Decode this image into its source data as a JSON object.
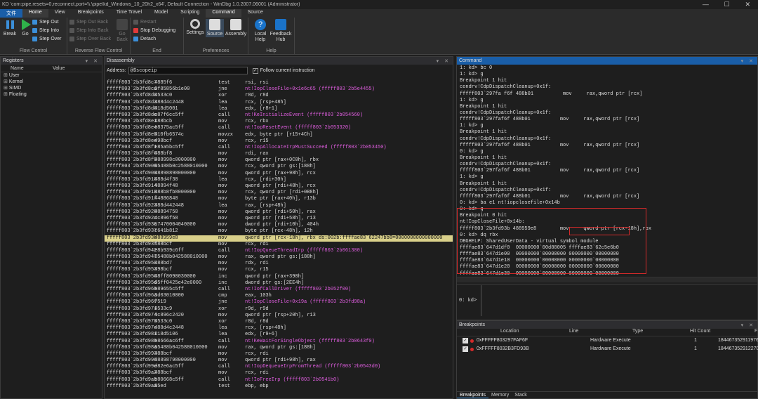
{
  "titlebar": {
    "title": "KD 'com:pipe,resets=0,reconnect,port=\\\\.\\pipe\\kd_Windows_10_20h2_x64', Default Connection  - WinDbg 1.0.2007.06001 (Administrator)"
  },
  "menu": [
    "文件",
    "Home",
    "View",
    "Breakpoints",
    "Time Travel",
    "Model",
    "Scripting",
    "Command",
    "Source"
  ],
  "ribbon": {
    "flow_control": {
      "label": "Flow Control",
      "break": "Break",
      "go": "Go",
      "step_out": "Step Out",
      "step_into": "Step Into",
      "step_over": "Step Over"
    },
    "reverse": {
      "label": "Reverse Flow Control",
      "step_out_back": "Step Out Back",
      "step_into_back": "Step Into Back",
      "step_over_back": "Step Over Back",
      "go_back": "Go Back"
    },
    "end": {
      "label": "End",
      "restart": "Restart",
      "stop": "Stop Debugging",
      "detach": "Detach"
    },
    "prefs": {
      "label": "Preferences",
      "settings": "Settings",
      "source": "Source",
      "assembly": "Assembly"
    },
    "help": {
      "local_help": "Local Help",
      "feedback_hub": "Feedback Hub",
      "help_label": "Help"
    }
  },
  "registers": {
    "title": "Registers",
    "col_name": "Name",
    "col_value": "Value",
    "items": [
      "User",
      "Kernel",
      "SIMD",
      "Floating"
    ]
  },
  "disassembly": {
    "title": "Disassembly",
    "address_label": "Address:",
    "address_value": "@$scopeip",
    "follow_label": "Follow current instruction",
    "rows": [
      [
        "fffff803`2b3fd8c7",
        "4885f6",
        "test",
        "rsi, rsi",
        0
      ],
      [
        "fffff803`2b3fd8ca",
        "0f85856b1e00",
        "jne",
        "nt!IopCloseFile+0x1e6c65 (fffff803`2b5e4455)",
        1
      ],
      [
        "fffff803`2b3fd8d0",
        "4533c0",
        "xor",
        "r8d, r8d",
        0
      ],
      [
        "fffff803`2b3fd8d3",
        "488d4c2448",
        "lea",
        "rcx, [rsp+48h]",
        0
      ],
      [
        "fffff803`2b3fd8d8",
        "418d5001",
        "lea",
        "edx, [r8+1]",
        0
      ],
      [
        "fffff803`2b3fd8dc",
        "e87f6cc5ff",
        "call",
        "nt!KeInitializeEvent (fffff803`2b054560)",
        1
      ],
      [
        "fffff803`2b3fd8e1",
        "488bcb",
        "mov",
        "rcx, rbx",
        0
      ],
      [
        "fffff803`2b3fd8e4",
        "e8375ac5ff",
        "call",
        "nt!IopResetEvent (fffff803`2b053320)",
        1
      ],
      [
        "fffff803`2b3fd8e9",
        "410fb6574c",
        "movzx",
        "edx, byte ptr [r15+4Ch]",
        0
      ],
      [
        "fffff803`2b3fd8ee",
        "498bcf",
        "mov",
        "rcx, r15",
        0
      ],
      [
        "fffff803`2b3fd8f1",
        "e85a5bc5ff",
        "call",
        "nt!IopAllocateIrpMustSucceed (fffff803`2b053450)",
        1
      ],
      [
        "fffff803`2b3fd8f6",
        "488bf8",
        "mov",
        "rdi, rax",
        0
      ],
      [
        "fffff803`2b3fd8f9",
        "488998c0000000",
        "mov",
        "qword ptr [rax+0C0h], rbx",
        0
      ],
      [
        "fffff803`2b3fd900",
        "65488b0c2588010000",
        "mov",
        "rcx, qword ptr gs:[188h]",
        0
      ],
      [
        "fffff803`2b3fd909",
        "48898898000000",
        "mov",
        "qword ptr [rax+98h], rcx",
        0
      ],
      [
        "fffff803`2b3fd910",
        "488d4f30",
        "lea",
        "rcx, [rdi+30h]",
        0
      ],
      [
        "fffff803`2b3fd914",
        "48894f48",
        "mov",
        "qword ptr [rdi+48h], rcx",
        0
      ],
      [
        "fffff803`2b3fd918",
        "488b8fb8000000",
        "mov",
        "rcx, qword ptr [rdi+0B8h]",
        0
      ],
      [
        "fffff803`2b3fd91f",
        "44886840",
        "mov",
        "byte ptr [rax+40h], r13b",
        0
      ],
      [
        "fffff803`2b3fd923",
        "488d442448",
        "lea",
        "rax, [rsp+48h]",
        0
      ],
      [
        "fffff803`2b3fd928",
        "48894750",
        "mov",
        "qword ptr [rdi+50h], rax",
        0
      ],
      [
        "fffff803`2b3fd92c",
        "4c896f58",
        "mov",
        "qword ptr [rdi+58h], r13",
        0
      ],
      [
        "fffff803`2b3fd930",
        "c7470004040000",
        "mov",
        "dword ptr [rdi+10h], 404h",
        0
      ],
      [
        "fffff803`2b3fd937",
        "c641b812",
        "mov",
        "byte ptr [rcx-48h], 12h",
        0
      ],
      [
        "fffff803`2b3fd93b",
        "488959e8",
        "mov",
        "qword ptr [rcx-18h], rbx ds:002b:ffffae83`62247bb8=0000000000000000",
        2
      ],
      [
        "fffff803`2b3fd93f",
        "488bcf",
        "mov",
        "rcx, rdi",
        0
      ],
      [
        "fffff803`2b3fd942",
        "e8b939c6ff",
        "call",
        "nt!IopQueueThreadIrp (fffff803`2b061300)",
        1
      ],
      [
        "fffff803`2b3fd947",
        "65488b042588010000",
        "mov",
        "rax, qword ptr gs:[188h]",
        0
      ],
      [
        "fffff803`2b3fd950",
        "488bd7",
        "mov",
        "rdx, rdi",
        0
      ],
      [
        "fffff803`2b3fd953",
        "498bcf",
        "mov",
        "rcx, r15",
        0
      ],
      [
        "fffff803`2b3fd956",
        "48ff8090030000",
        "inc",
        "qword ptr [rax+390h]",
        0
      ],
      [
        "fffff803`2b3fd95d",
        "65ff0425e42e0000",
        "inc",
        "dword ptr gs:[2EE4h]",
        0
      ],
      [
        "fffff803`2b3fd965",
        "e89655c5ff",
        "call",
        "nt!IofCallDriver (fffff803`2b052f00)",
        1
      ],
      [
        "fffff803`2b3fd96a",
        "3d03010000",
        "cmp",
        "eax, 103h",
        0
      ],
      [
        "fffff803`2b3fd96f",
        "7519",
        "jne",
        "nt!IopCloseFile+0x19a (fffff803`2b3fd98a)",
        1
      ],
      [
        "fffff803`2b3fd971",
        "4533c9",
        "xor",
        "r9d, r9d",
        0
      ],
      [
        "fffff803`2b3fd974",
        "4c896c2420",
        "mov",
        "qword ptr [rsp+20h], r13",
        0
      ],
      [
        "fffff803`2b3fd979",
        "4533c0",
        "xor",
        "r8d, r8d",
        0
      ],
      [
        "fffff803`2b3fd97c",
        "488d4c2448",
        "lea",
        "rcx, [rsp+48h]",
        0
      ],
      [
        "fffff803`2b3fd981",
        "418d5106",
        "lea",
        "edx, [r9+6]",
        0
      ],
      [
        "fffff803`2b3fd985",
        "e8666ac6ff",
        "call",
        "nt!KeWaitForSingleObject (fffff803`2b0643f0)",
        1
      ],
      [
        "fffff803`2b3fd98a",
        "65488b042588010000",
        "mov",
        "rax, qword ptr gs:[188h]",
        0
      ],
      [
        "fffff803`2b3fd993",
        "488bcf",
        "mov",
        "rcx, rdi",
        0
      ],
      [
        "fffff803`2b3fd996",
        "48898798000000",
        "mov",
        "qword ptr [rdi+98h], rax",
        0
      ],
      [
        "fffff803`2b3fd99d",
        "e82e6ac5ff",
        "call",
        "nt!IopDequeueIrpFromThread (fffff803`2b0543d0)",
        1
      ],
      [
        "fffff803`2b3fd9a2",
        "488bcf",
        "mov",
        "rcx, rdi",
        0
      ],
      [
        "fffff803`2b3fd9a5",
        "e80668c5ff",
        "call",
        "nt!IoFreeIrp (fffff803`2b0541b0)",
        1
      ],
      [
        "fffff803`2b3fd9aa",
        "85ed",
        "test",
        "ebp, ebp",
        0
      ]
    ]
  },
  "command": {
    "title": "Command",
    "lines": [
      "1: kd> bc 0",
      "1: kd> g",
      "Breakpoint 1 hit",
      "condrv!CdpDispatchCleanup+0x1f:",
      "fffff803`297fa f6f 488b01          mov     rax,qword ptr [rcx]",
      "1: kd> g",
      "Breakpoint 1 hit",
      "condrv!CdpDispatchCleanup+0x1f:",
      "fffff803`297faf6f 488b01          mov     rax,qword ptr [rcx]",
      "1: kd> g",
      "Breakpoint 1 hit",
      "condrv!CdpDispatchCleanup+0x1f:",
      "fffff803`297faf6f 488b01          mov     rax,qword ptr [rcx]",
      "0: kd> g",
      "Breakpoint 1 hit",
      "condrv!CdpDispatchCleanup+0x1f:",
      "fffff803`297faf6f 488b01          mov     rax,qword ptr [rcx]",
      "1: kd> g",
      "Breakpoint 1 hit",
      "condrv!CdpDispatchCleanup+0x1f:",
      "fffff803`297faf6f 488b01          mov     rax,qword ptr [rcx]",
      "0: kd> ba e1 nt!iopclosefile+0x14b",
      "0: kd> g",
      "Breakpoint 0 hit",
      "nt!IopCloseFile+0x14b:",
      "fffff803`2b3fd93b 488959e8        mov     qword ptr [rcx-18h],rbx",
      "0: kd> dq rbx",
      "DBGHELP: SharedUserData - virtual symbol module",
      "ffffae83`647d1df0  00000000`00d80005 ffffae83`62c5e6b0",
      "ffffae83`647d1e00  00000000`00000000 00000000`00000000",
      "ffffae83`647d1e10  00000000`00000000 00000000`00000000",
      "ffffae83`647d1e20  00000000`00000000 00000000`00000000",
      "ffffae83`647d1e30  00000000`00000000 00000000`00000000",
      "ffffae83`647d1e40  00000000`0004000a 00000000`0038001c",
      "ffffae83`647d1e50  ffffbe88`2519b950 00000000`00000000",
      "ffffae83`647d1e60  00000001`00000000 00000000`00000000"
    ],
    "prompt": "0: kd>"
  },
  "breakpoints": {
    "title": "Breakpoints",
    "headers": [
      "Location",
      "Line",
      "Type",
      "Hit Count",
      "F"
    ],
    "rows": [
      [
        "0xFFFFF803297FAF6F",
        "",
        "Hardware Execute",
        "1",
        "184467352911976"
      ],
      [
        "0xFFFFF8032B3FD93B",
        "",
        "Hardware Execute",
        "1",
        "184467352912270"
      ]
    ],
    "tabs": [
      "Breakpoints",
      "Memory",
      "Stack"
    ]
  },
  "colors": {
    "accent": "#1a5ea8",
    "highlight": "#d9d08a",
    "symbol": "#e05ee0",
    "redbox": "#d42a2a"
  }
}
